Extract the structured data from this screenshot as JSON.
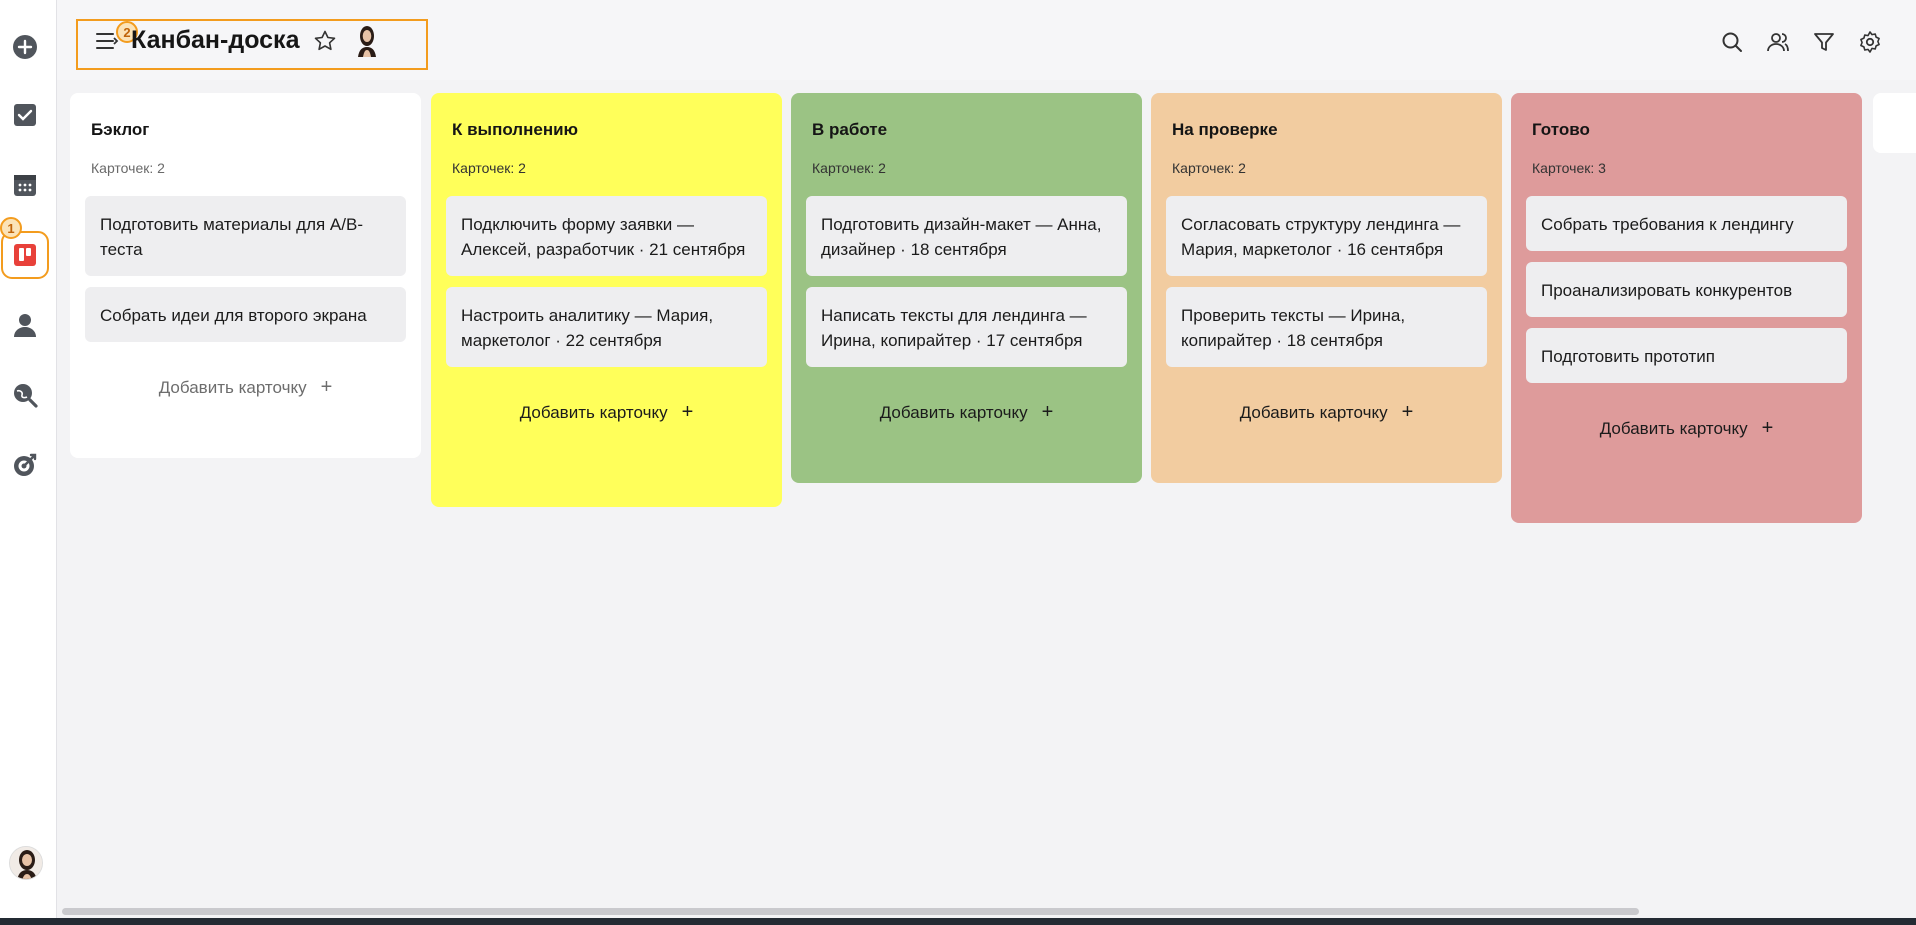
{
  "rail": {
    "active_badge": "1",
    "items": [
      {
        "name": "add",
        "icon": "plus-circle-icon"
      },
      {
        "name": "tasks",
        "icon": "checkbox-icon"
      },
      {
        "name": "calendar",
        "icon": "calendar-icon"
      },
      {
        "name": "kanban",
        "icon": "kanban-board-icon"
      },
      {
        "name": "profile",
        "icon": "user-icon"
      },
      {
        "name": "search",
        "icon": "search-globe-icon"
      },
      {
        "name": "goals",
        "icon": "target-check-icon"
      }
    ]
  },
  "header": {
    "title": "Канбан-доска",
    "badge": "2",
    "tools": [
      "search-icon",
      "users-icon",
      "filter-icon",
      "settings-icon"
    ]
  },
  "columns": [
    {
      "title": "Бэклог",
      "count": "Карточек: 2",
      "color": "#ffffff",
      "cards": [
        "Подготовить материалы для A/B-теста",
        "Собрать идеи для второго экрана"
      ],
      "add_label": "Добавить карточку"
    },
    {
      "title": "К выполнению",
      "count": "Карточек: 2",
      "color": "#ffff5a",
      "cards": [
        "Подключить форму заявки — Алексей, разработчик · 21 сентября",
        "Настроить аналитику — Мария, маркетолог · 22 сентября"
      ],
      "add_label": "Добавить карточку"
    },
    {
      "title": "В работе",
      "count": "Карточек: 2",
      "color": "#9bc384",
      "cards": [
        "Подготовить дизайн-макет — Анна, дизайнер · 18 сентября",
        "Написать тексты для лендинга — Ирина, копирайтер · 17 сентября"
      ],
      "add_label": "Добавить карточку"
    },
    {
      "title": "На проверке",
      "count": "Карточек: 2",
      "color": "#f2cca0",
      "cards": [
        "Согласовать структуру лендинга — Мария, маркетолог · 16 сентября",
        "Проверить тексты — Ирина, копирайтер · 18 сентября"
      ],
      "add_label": "Добавить карточку"
    },
    {
      "title": "Готово",
      "count": "Карточек: 3",
      "color": "#de9b9b",
      "cards": [
        "Собрать требования к лендингу",
        "Проанализировать конкурентов",
        "Подготовить прототип"
      ],
      "add_label": "Добавить карточку"
    }
  ],
  "colors": {
    "accent": "#f39c1e"
  }
}
